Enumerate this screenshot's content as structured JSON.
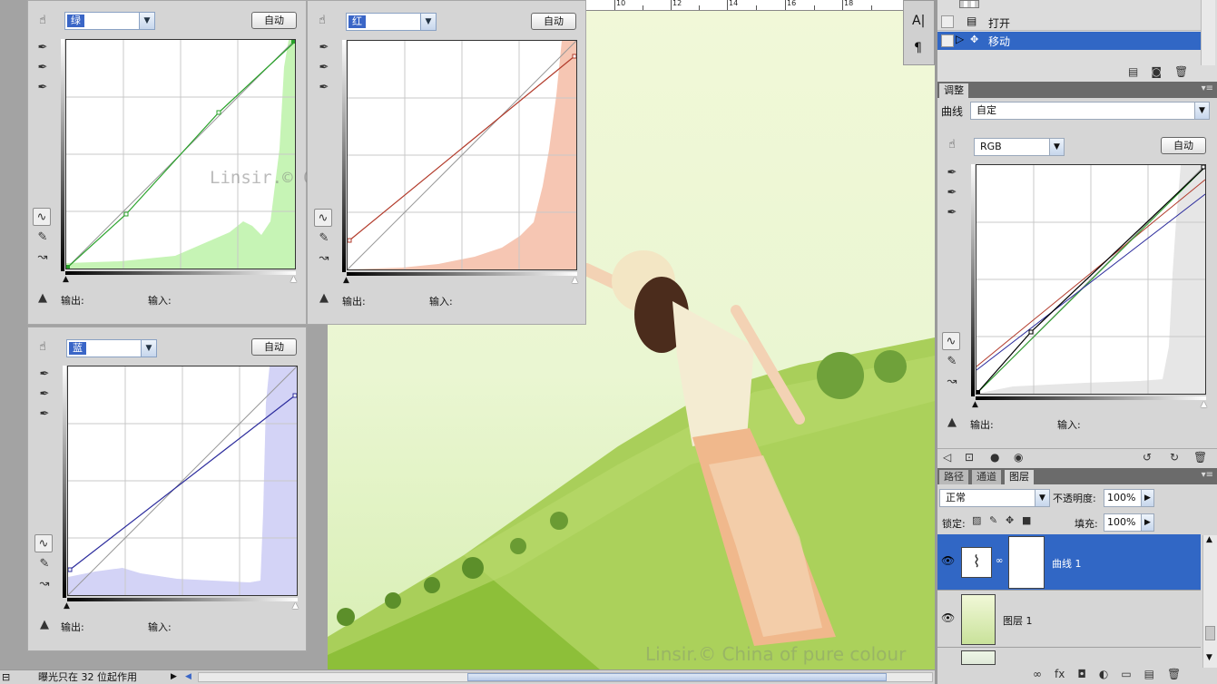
{
  "ruler_numbers": [
    "10",
    "12",
    "14",
    "16",
    "18"
  ],
  "curves_green": {
    "channel": "绿",
    "auto": "自动",
    "output": "输出:",
    "input": "输入:",
    "watermark": "Linsir.© China of pure colour"
  },
  "curves_red": {
    "channel": "红",
    "auto": "自动",
    "output": "输出:",
    "input": "输入:"
  },
  "curves_blue": {
    "channel": "蓝",
    "auto": "自动",
    "output": "输出:",
    "input": "输入:"
  },
  "history": {
    "items": [
      {
        "label": "打开"
      },
      {
        "label": "移动"
      }
    ]
  },
  "adjust": {
    "tab": "调整",
    "preset_label": "曲线",
    "preset_value": "自定",
    "channel": "RGB",
    "auto": "自动",
    "output": "输出:",
    "input": "输入:"
  },
  "layers_panel": {
    "tabs": [
      "路径",
      "通道",
      "图层"
    ],
    "blend_mode": "正常",
    "opacity_label": "不透明度:",
    "opacity": "100%",
    "lock_label": "锁定:",
    "fill_label": "填充:",
    "fill": "100%",
    "layers": [
      {
        "name": "曲线 1"
      },
      {
        "name": "图层 1"
      }
    ]
  },
  "status": {
    "text": "曝光只在 32 位起作用"
  },
  "colors": {
    "accent": "#3167c5",
    "green": "#c9f4b8",
    "red": "#f6c6b3",
    "blue": "#d3d3f6"
  }
}
